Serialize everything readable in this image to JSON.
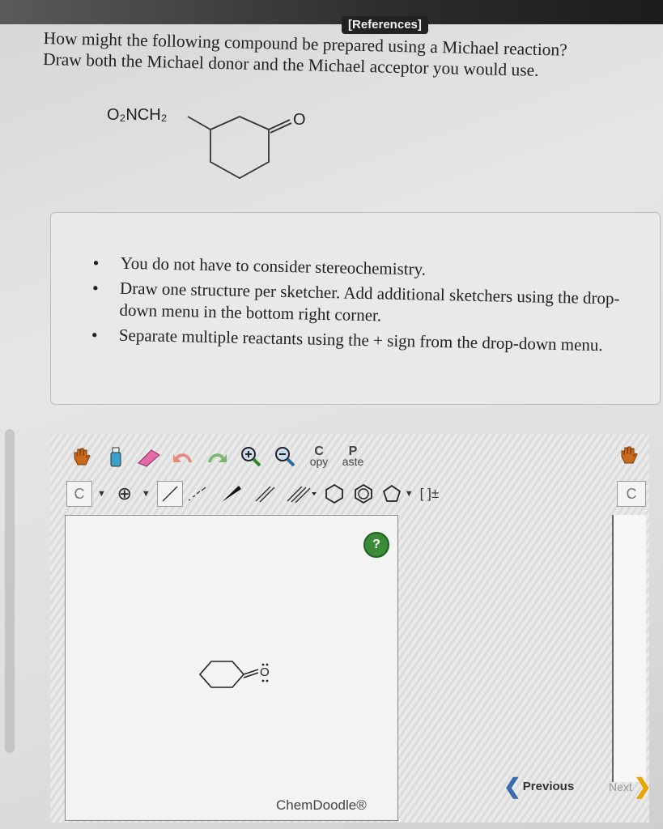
{
  "header": {
    "references_label": "[References]"
  },
  "question": {
    "line1": "How might the following compound be prepared using a Michael reaction?",
    "line2": "Draw both the Michael donor and the Michael acceptor you would use."
  },
  "molecule": {
    "substituent": "O₂NCH₂",
    "carbonyl": "O"
  },
  "instructions": [
    "You do not have to consider stereochemistry.",
    "Draw one structure per sketcher. Add additional sketchers using the drop-down menu in the bottom right corner.",
    "Separate multiple reactants using the + sign from the drop-down menu."
  ],
  "toolbar": {
    "copy_top": "C",
    "copy_bottom": "opy",
    "paste_top": "P",
    "paste_bottom": "aste",
    "atom_label": "C",
    "charge_bracket": "[ ]±",
    "side_atom_label": "C"
  },
  "canvas": {
    "help": "?",
    "brand": "ChemDoodle®",
    "drawn_carbonyl": "O"
  },
  "nav": {
    "previous": "Previous",
    "next": "Next"
  },
  "colors": {
    "help_green": "#3a8a3a",
    "prev_blue": "#3a6ab0",
    "next_orange": "#e8a400"
  }
}
